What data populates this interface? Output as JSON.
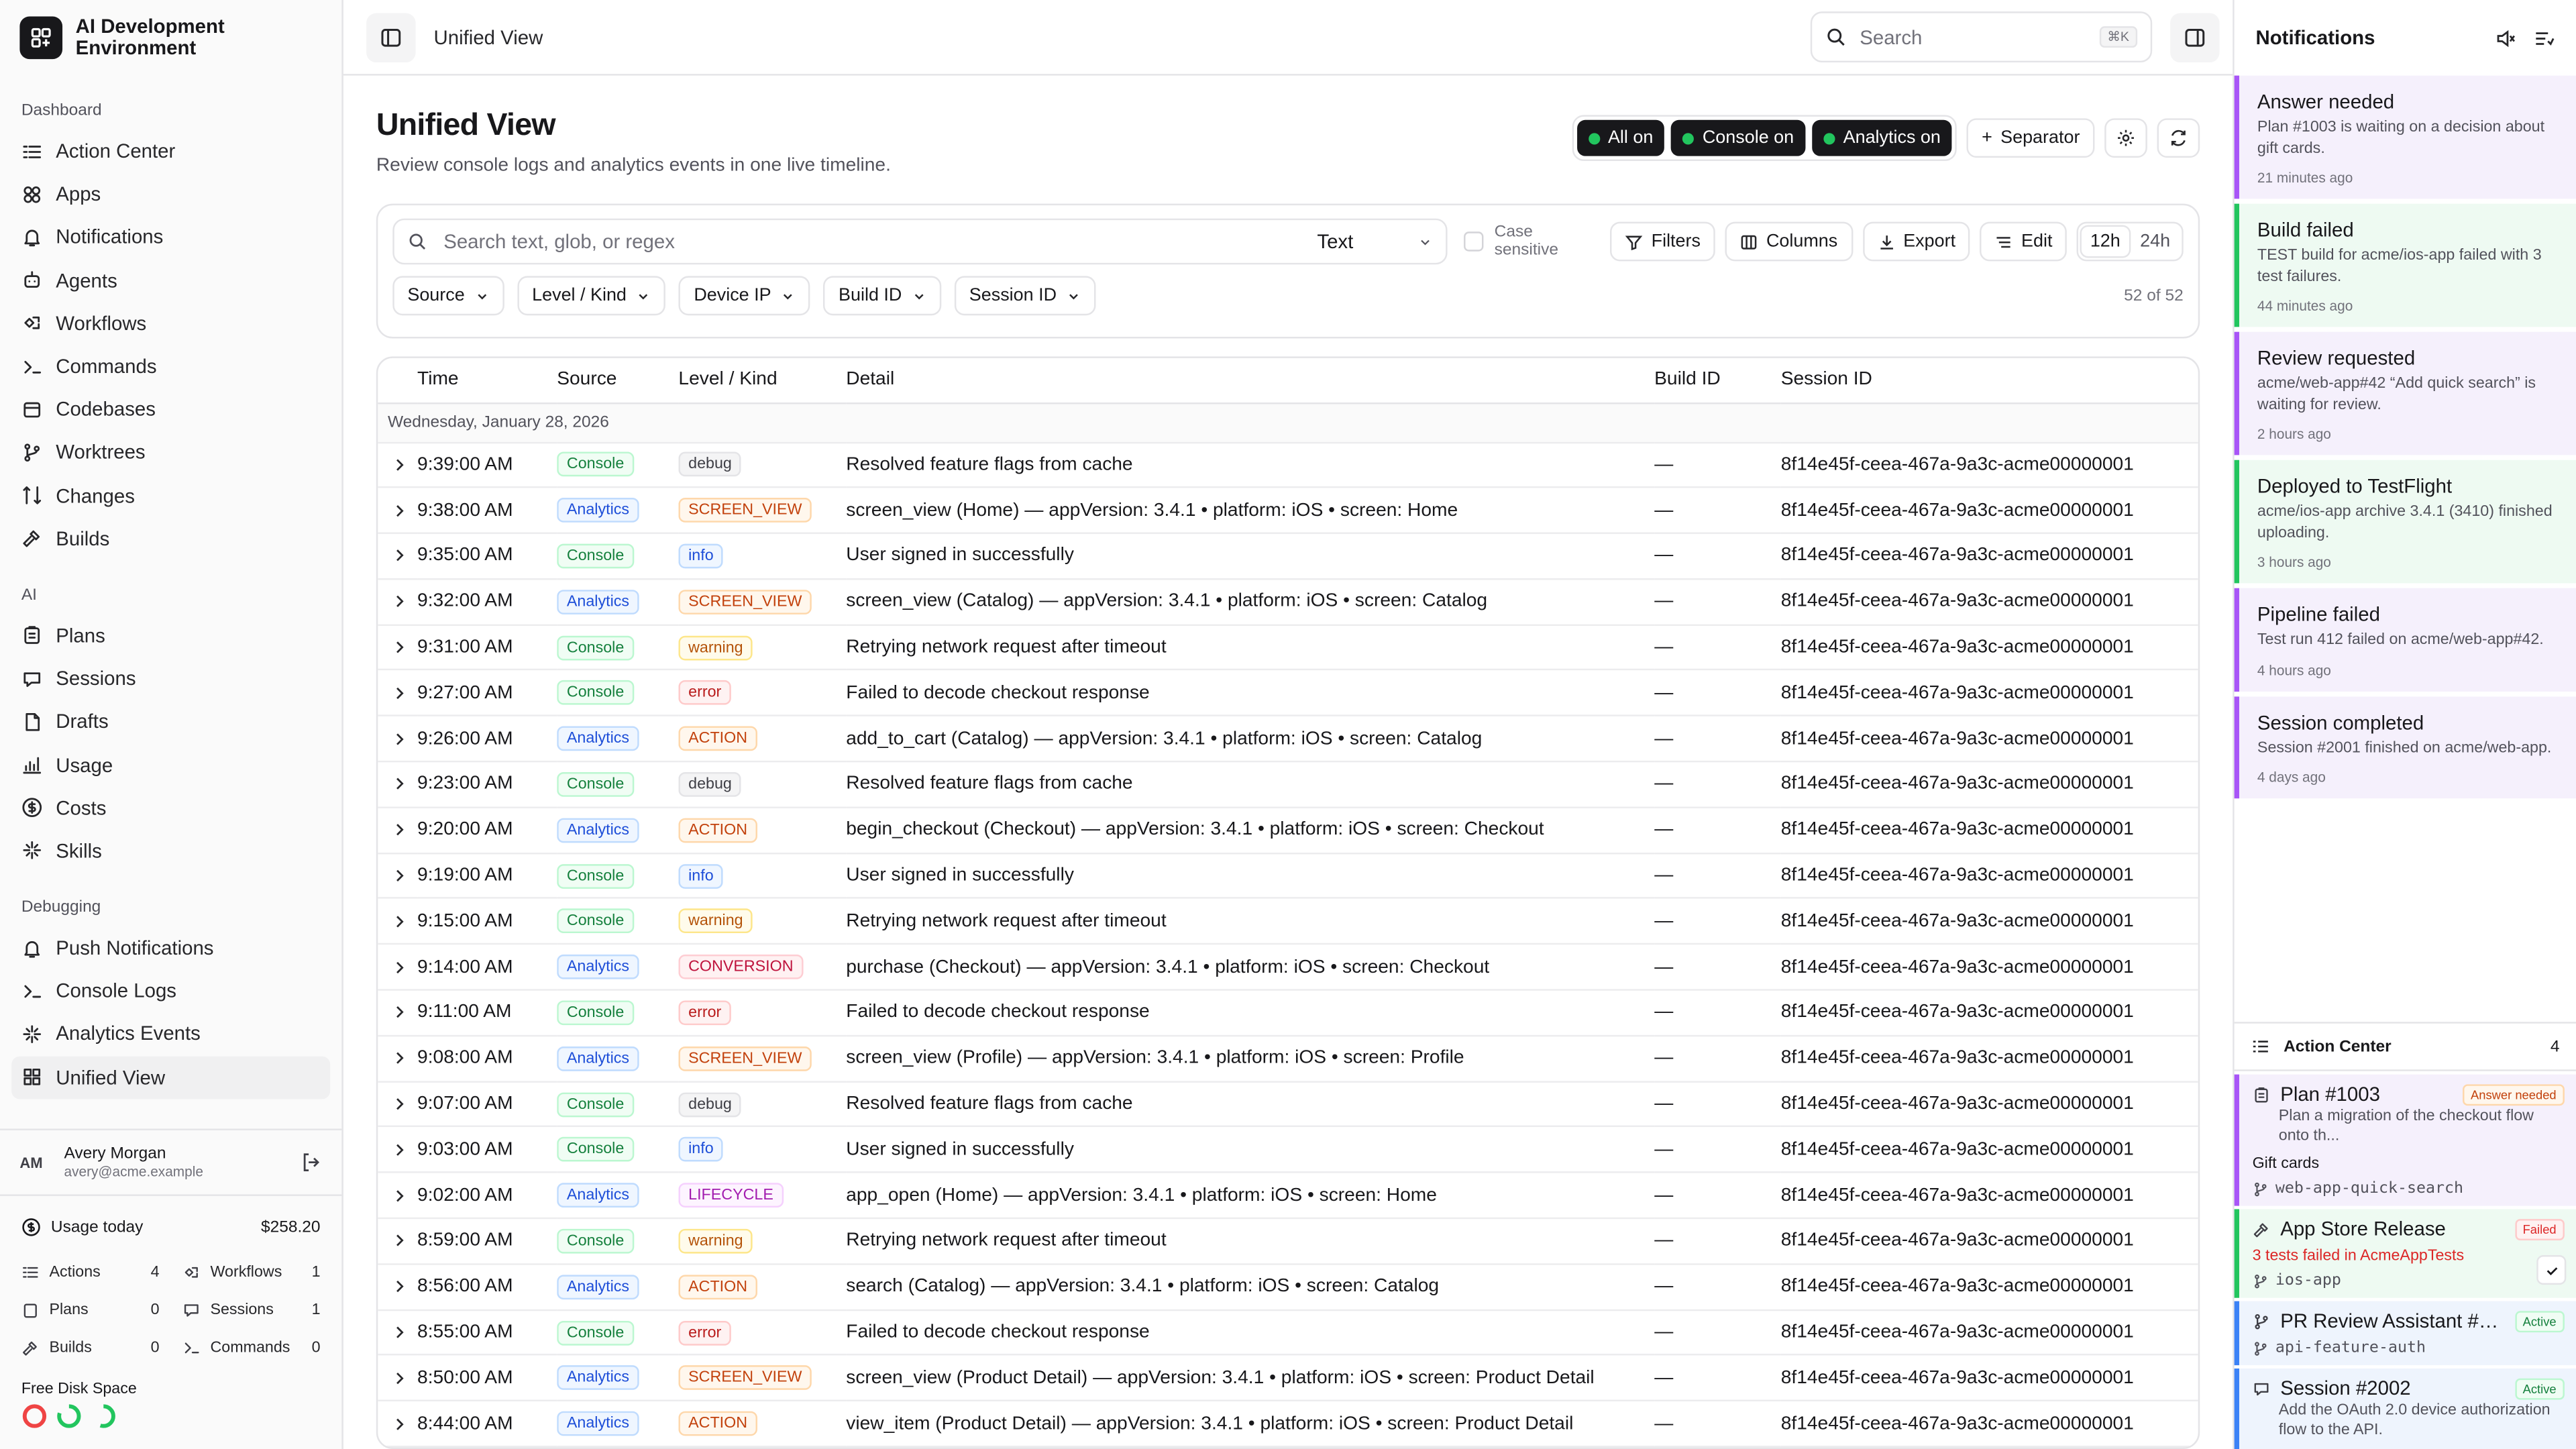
{
  "brand": {
    "name": "AI Development Environment"
  },
  "sidebar": {
    "sections": [
      {
        "heading": "Dashboard",
        "items": [
          {
            "label": "Action Center",
            "icon": "action-center-icon"
          },
          {
            "label": "Apps",
            "icon": "apps-icon"
          },
          {
            "label": "Notifications",
            "icon": "bell-icon"
          },
          {
            "label": "Agents",
            "icon": "agents-icon"
          },
          {
            "label": "Workflows",
            "icon": "workflows-icon"
          },
          {
            "label": "Commands",
            "icon": "terminal-icon"
          },
          {
            "label": "Codebases",
            "icon": "codebases-icon"
          },
          {
            "label": "Worktrees",
            "icon": "branch-icon"
          },
          {
            "label": "Changes",
            "icon": "changes-icon"
          },
          {
            "label": "Builds",
            "icon": "hammer-icon"
          }
        ]
      },
      {
        "heading": "AI",
        "items": [
          {
            "label": "Plans",
            "icon": "clipboard-icon"
          },
          {
            "label": "Sessions",
            "icon": "chat-icon"
          },
          {
            "label": "Drafts",
            "icon": "drafts-icon"
          },
          {
            "label": "Usage",
            "icon": "chart-icon"
          },
          {
            "label": "Costs",
            "icon": "dollar-icon"
          },
          {
            "label": "Skills",
            "icon": "sparkle-icon"
          }
        ]
      },
      {
        "heading": "Debugging",
        "items": [
          {
            "label": "Push Notifications",
            "icon": "bell-icon"
          },
          {
            "label": "Console Logs",
            "icon": "terminal-icon"
          },
          {
            "label": "Analytics Events",
            "icon": "sparkle-icon"
          },
          {
            "label": "Unified View",
            "icon": "grid-icon",
            "active": true
          }
        ]
      }
    ],
    "user": {
      "initials": "AM",
      "name": "Avery Morgan",
      "email": "avery@acme.example"
    },
    "usage": {
      "label": "Usage today",
      "amount": "$258.20",
      "stats": [
        {
          "label": "Actions",
          "value": "4"
        },
        {
          "label": "Workflows",
          "value": "1"
        },
        {
          "label": "Plans",
          "value": "0"
        },
        {
          "label": "Sessions",
          "value": "1"
        },
        {
          "label": "Builds",
          "value": "0"
        },
        {
          "label": "Commands",
          "value": "0"
        }
      ]
    },
    "disk": {
      "label": "Free Disk Space",
      "rings": [
        {
          "color": "#ef4444",
          "fraction": 1.0
        },
        {
          "color": "#22c55e",
          "fraction": 0.8
        },
        {
          "color": "#22c55e",
          "fraction": 0.55
        }
      ]
    }
  },
  "topbar": {
    "title": "Unified View",
    "search_placeholder": "Search",
    "shortcut": "⌘K"
  },
  "page": {
    "title": "Unified View",
    "subtitle": "Review console logs and analytics events in one live timeline.",
    "toggles": [
      "All on",
      "Console on",
      "Analytics on"
    ],
    "separator_label": "Separator",
    "search_placeholder": "Search text, glob, or regex",
    "search_mode": "Text",
    "case_label": "Case sensitive",
    "buttons": {
      "filters": "Filters",
      "columns": "Columns",
      "export": "Export",
      "edit": "Edit"
    },
    "ranges": [
      "12h",
      "24h"
    ],
    "dropdowns": [
      "Source",
      "Level / Kind",
      "Device IP",
      "Build ID",
      "Session ID"
    ],
    "count": "52 of 52"
  },
  "table": {
    "headers": [
      "Time",
      "Source",
      "Level / Kind",
      "Detail",
      "Build ID",
      "Session ID"
    ],
    "date_label": "Wednesday, January 28, 2026",
    "rows": [
      {
        "time": "9:39:00 AM",
        "source": "Console",
        "level": "debug",
        "detail": "Resolved feature flags from cache",
        "build": "—",
        "session": "8f14e45f-ceea-467a-9a3c-acme00000001"
      },
      {
        "time": "9:38:00 AM",
        "source": "Analytics",
        "level": "SCREEN_VIEW",
        "detail": "screen_view (Home) — appVersion: 3.4.1 • platform: iOS • screen: Home",
        "build": "—",
        "session": "8f14e45f-ceea-467a-9a3c-acme00000001"
      },
      {
        "time": "9:35:00 AM",
        "source": "Console",
        "level": "info",
        "detail": "User signed in successfully",
        "build": "—",
        "session": "8f14e45f-ceea-467a-9a3c-acme00000001"
      },
      {
        "time": "9:32:00 AM",
        "source": "Analytics",
        "level": "SCREEN_VIEW",
        "detail": "screen_view (Catalog) — appVersion: 3.4.1 • platform: iOS • screen: Catalog",
        "build": "—",
        "session": "8f14e45f-ceea-467a-9a3c-acme00000001"
      },
      {
        "time": "9:31:00 AM",
        "source": "Console",
        "level": "warning",
        "detail": "Retrying network request after timeout",
        "build": "—",
        "session": "8f14e45f-ceea-467a-9a3c-acme00000001"
      },
      {
        "time": "9:27:00 AM",
        "source": "Console",
        "level": "error",
        "detail": "Failed to decode checkout response",
        "build": "—",
        "session": "8f14e45f-ceea-467a-9a3c-acme00000001"
      },
      {
        "time": "9:26:00 AM",
        "source": "Analytics",
        "level": "ACTION",
        "detail": "add_to_cart (Catalog) — appVersion: 3.4.1 • platform: iOS • screen: Catalog",
        "build": "—",
        "session": "8f14e45f-ceea-467a-9a3c-acme00000001"
      },
      {
        "time": "9:23:00 AM",
        "source": "Console",
        "level": "debug",
        "detail": "Resolved feature flags from cache",
        "build": "—",
        "session": "8f14e45f-ceea-467a-9a3c-acme00000001"
      },
      {
        "time": "9:20:00 AM",
        "source": "Analytics",
        "level": "ACTION",
        "detail": "begin_checkout (Checkout) — appVersion: 3.4.1 • platform: iOS • screen: Checkout",
        "build": "—",
        "session": "8f14e45f-ceea-467a-9a3c-acme00000001"
      },
      {
        "time": "9:19:00 AM",
        "source": "Console",
        "level": "info",
        "detail": "User signed in successfully",
        "build": "—",
        "session": "8f14e45f-ceea-467a-9a3c-acme00000001"
      },
      {
        "time": "9:15:00 AM",
        "source": "Console",
        "level": "warning",
        "detail": "Retrying network request after timeout",
        "build": "—",
        "session": "8f14e45f-ceea-467a-9a3c-acme00000001"
      },
      {
        "time": "9:14:00 AM",
        "source": "Analytics",
        "level": "CONVERSION",
        "detail": "purchase (Checkout) — appVersion: 3.4.1 • platform: iOS • screen: Checkout",
        "build": "—",
        "session": "8f14e45f-ceea-467a-9a3c-acme00000001"
      },
      {
        "time": "9:11:00 AM",
        "source": "Console",
        "level": "error",
        "detail": "Failed to decode checkout response",
        "build": "—",
        "session": "8f14e45f-ceea-467a-9a3c-acme00000001"
      },
      {
        "time": "9:08:00 AM",
        "source": "Analytics",
        "level": "SCREEN_VIEW",
        "detail": "screen_view (Profile) — appVersion: 3.4.1 • platform: iOS • screen: Profile",
        "build": "—",
        "session": "8f14e45f-ceea-467a-9a3c-acme00000001"
      },
      {
        "time": "9:07:00 AM",
        "source": "Console",
        "level": "debug",
        "detail": "Resolved feature flags from cache",
        "build": "—",
        "session": "8f14e45f-ceea-467a-9a3c-acme00000001"
      },
      {
        "time": "9:03:00 AM",
        "source": "Console",
        "level": "info",
        "detail": "User signed in successfully",
        "build": "—",
        "session": "8f14e45f-ceea-467a-9a3c-acme00000001"
      },
      {
        "time": "9:02:00 AM",
        "source": "Analytics",
        "level": "LIFECYCLE",
        "detail": "app_open (Home) — appVersion: 3.4.1 • platform: iOS • screen: Home",
        "build": "—",
        "session": "8f14e45f-ceea-467a-9a3c-acme00000001"
      },
      {
        "time": "8:59:00 AM",
        "source": "Console",
        "level": "warning",
        "detail": "Retrying network request after timeout",
        "build": "—",
        "session": "8f14e45f-ceea-467a-9a3c-acme00000001"
      },
      {
        "time": "8:56:00 AM",
        "source": "Analytics",
        "level": "ACTION",
        "detail": "search (Catalog) — appVersion: 3.4.1 • platform: iOS • screen: Catalog",
        "build": "—",
        "session": "8f14e45f-ceea-467a-9a3c-acme00000001"
      },
      {
        "time": "8:55:00 AM",
        "source": "Console",
        "level": "error",
        "detail": "Failed to decode checkout response",
        "build": "—",
        "session": "8f14e45f-ceea-467a-9a3c-acme00000001"
      },
      {
        "time": "8:50:00 AM",
        "source": "Analytics",
        "level": "SCREEN_VIEW",
        "detail": "screen_view (Product Detail) — appVersion: 3.4.1 • platform: iOS • screen: Product Detail",
        "build": "—",
        "session": "8f14e45f-ceea-467a-9a3c-acme00000001"
      },
      {
        "time": "8:44:00 AM",
        "source": "Analytics",
        "level": "ACTION",
        "detail": "view_item (Product Detail) — appVersion: 3.4.1 • platform: iOS • screen: Product Detail",
        "build": "—",
        "session": "8f14e45f-ceea-467a-9a3c-acme00000001"
      }
    ]
  },
  "notifications": {
    "title": "Notifications",
    "items": [
      {
        "title": "Answer needed",
        "body": "Plan #1003 is waiting on a decision about gift cards.",
        "time": "21 minutes ago",
        "tone": "purple"
      },
      {
        "title": "Build failed",
        "body": "TEST build for acme/ios-app failed with 3 test failures.",
        "time": "44 minutes ago",
        "tone": "green"
      },
      {
        "title": "Review requested",
        "body": "acme/web-app#42 “Add quick search” is waiting for review.",
        "time": "2 hours ago",
        "tone": "purple"
      },
      {
        "title": "Deployed to TestFlight",
        "body": "acme/ios-app archive 3.4.1 (3410) finished uploading.",
        "time": "3 hours ago",
        "tone": "green"
      },
      {
        "title": "Pipeline failed",
        "body": "Test run 412 failed on acme/web-app#42.",
        "time": "4 hours ago",
        "tone": "purple"
      },
      {
        "title": "Session completed",
        "body": "Session #2001 finished on acme/web-app.",
        "time": "4 days ago",
        "tone": "purple"
      }
    ]
  },
  "action_center": {
    "title": "Action Center",
    "count": "4",
    "cards": [
      {
        "title": "Plan #1003",
        "tag": "Answer needed",
        "desc": "Plan a migration of the checkout flow onto th...",
        "meta": "Gift cards",
        "branch": "web-app-quick-search",
        "tone": "purple"
      },
      {
        "title": "App Store Release",
        "tag": "Failed",
        "fail": "3 tests failed in AcmeAppTests",
        "branch": "ios-app",
        "tone": "green"
      },
      {
        "title": "PR Review Assistant #4...",
        "tag": "Active",
        "branch": "api-feature-auth",
        "tone": "blue"
      },
      {
        "title": "Session #2002",
        "tag": "Active",
        "desc": "Add the OAuth 2.0 device authorization flow to the API.",
        "tone": "blue"
      }
    ]
  }
}
